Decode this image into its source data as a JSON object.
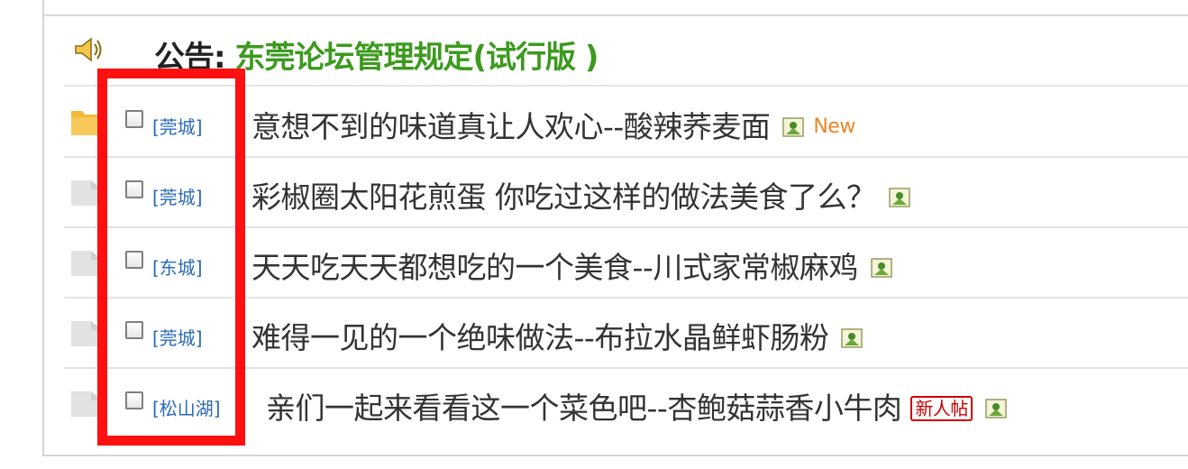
{
  "announcement": {
    "label": "公告:",
    "link_text": "东莞论坛管理规定(试行版 )"
  },
  "threads": [
    {
      "type": "[莞城]",
      "title": "意想不到的味道真让人欢心--酸辣荞麦面",
      "new_label": "New",
      "folder": "new"
    },
    {
      "type": "[莞城]",
      "title": "彩椒圈太阳花煎蛋 你吃过这样的做法美食了么？",
      "folder": "normal"
    },
    {
      "type": "[东城]",
      "title": "天天吃天天都想吃的一个美食--川式家常椒麻鸡",
      "folder": "normal"
    },
    {
      "type": "[莞城]",
      "title": "难得一见的一个绝味做法--布拉水晶鲜虾肠粉",
      "folder": "normal"
    },
    {
      "type": "[松山湖]",
      "title": "亲们一起来看看这一个菜色吧--杏鲍菇蒜香小牛肉",
      "badge": "新人帖",
      "folder": "normal"
    }
  ],
  "colors": {
    "announce_link": "#3c9a1e",
    "type_link": "#2a6ab8",
    "new_tag": "#e8862a",
    "highlight": "#ff1010"
  }
}
